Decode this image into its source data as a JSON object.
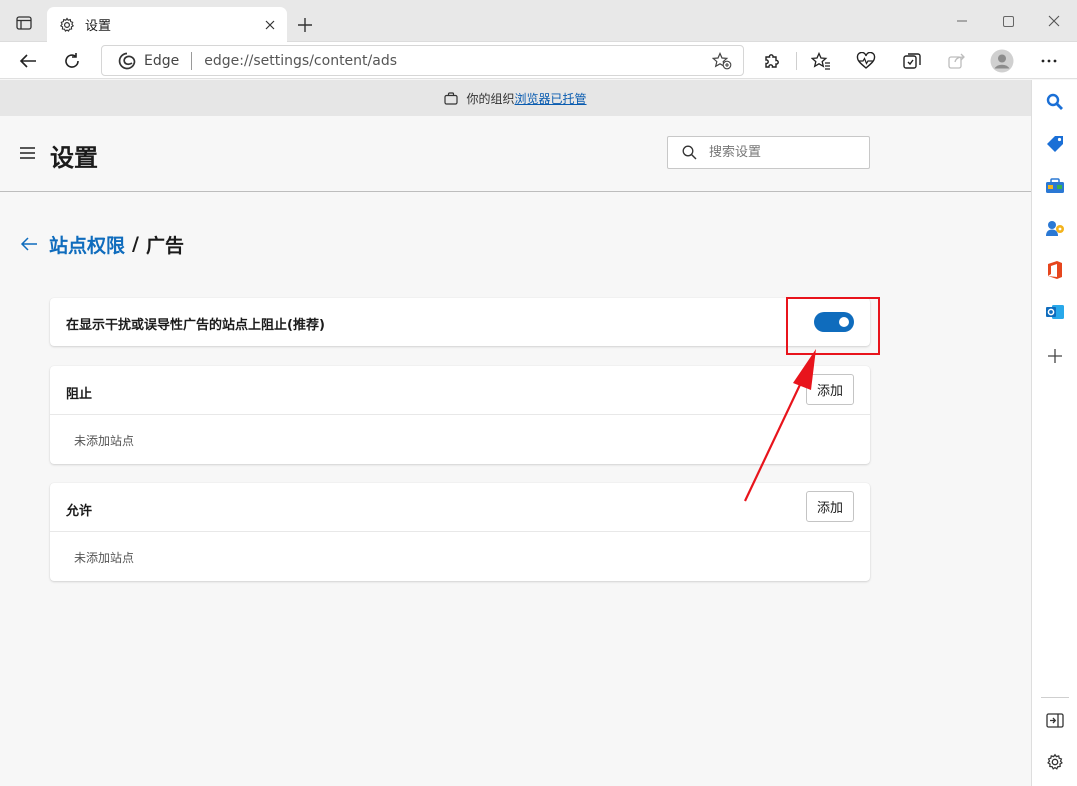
{
  "browser": {
    "tab_title": "设置",
    "address_label": "Edge",
    "url": "edge://settings/content/ads"
  },
  "banner": {
    "prefix": "你的组织",
    "link": "浏览器已托管"
  },
  "settings": {
    "title": "设置",
    "search_placeholder": "搜索设置"
  },
  "breadcrumb": {
    "parent": "站点权限",
    "separator": "/",
    "current": "广告"
  },
  "ads_toggle": {
    "label": "在显示干扰或误导性广告的站点上阻止(推荐)",
    "enabled": true,
    "accent_color": "#0f6cbd"
  },
  "block_section": {
    "title": "阻止",
    "add_label": "添加",
    "empty_text": "未添加站点"
  },
  "allow_section": {
    "title": "允许",
    "add_label": "添加",
    "empty_text": "未添加站点"
  },
  "annotation": {
    "color": "#e8141c"
  },
  "sidebar": {
    "items": [
      "search-icon",
      "shopping-tag-icon",
      "tools-icon",
      "games-icon",
      "office-icon",
      "outlook-icon",
      "add-icon"
    ]
  }
}
